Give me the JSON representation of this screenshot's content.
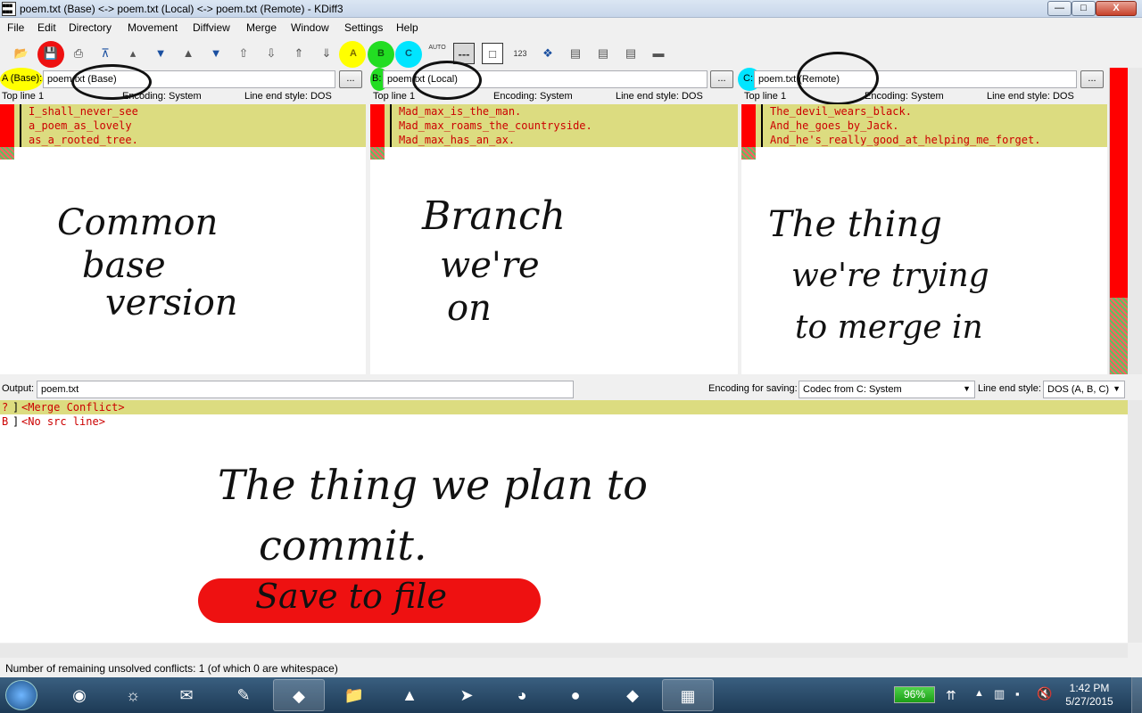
{
  "window": {
    "title": "poem.txt (Base) <-> poem.txt (Local) <-> poem.txt (Remote) - KDiff3",
    "controls": {
      "minimize": "—",
      "maximize": "□",
      "close": "X"
    }
  },
  "menu": [
    "File",
    "Edit",
    "Directory",
    "Movement",
    "Diffview",
    "Merge",
    "Window",
    "Settings",
    "Help"
  ],
  "toolbar": {
    "a": "A",
    "b": "B",
    "c": "C",
    "auto": "AUTO",
    "num": "123"
  },
  "panes": [
    {
      "label": "A (Base):",
      "file": "poem.txt (Base)",
      "top_line": "Top line 1",
      "encoding": "Encoding: System",
      "line_end": "Line end style: DOS",
      "lines": [
        "I_shall_never_see",
        "a_poem_as_lovely",
        "as_a_rooted_tree."
      ],
      "annotation": [
        "Common",
        "base",
        "version"
      ]
    },
    {
      "label": "B:",
      "file": "poem.txt (Local)",
      "top_line": "Top line 1",
      "encoding": "Encoding: System",
      "line_end": "Line end style: DOS",
      "lines": [
        "Mad_max_is_the_man.",
        "Mad_max_roams_the_countryside.",
        "Mad_max_has_an_ax."
      ],
      "annotation": [
        "Branch",
        "we're",
        "on"
      ]
    },
    {
      "label": "C:",
      "file": "poem.txt (Remote)",
      "top_line": "Top line 1",
      "encoding": "Encoding: System",
      "line_end": "Line end style: DOS",
      "lines": [
        "The_devil_wears_black.",
        "And_he_goes_by_Jack.",
        "And_he's_really_good_at_helping_me_forget."
      ],
      "annotation": [
        "The thing",
        "we're trying",
        "to merge in"
      ]
    }
  ],
  "file_button": "...",
  "output": {
    "label": "Output:",
    "file": "poem.txt",
    "encoding_label": "Encoding for saving:",
    "encoding_value": "Codec from C: System",
    "line_end_label": "Line end style:",
    "line_end_value": "DOS (A, B, C)",
    "lines": [
      {
        "marker": "?",
        "text": "<Merge Conflict>"
      },
      {
        "marker": "B",
        "text": "<No src line>"
      }
    ],
    "annotation": [
      "The thing we plan to",
      "commit."
    ],
    "save_note": "Save to file"
  },
  "status": "Number of remaining unsolved conflicts: 1 (of which 0 are whitespace)",
  "taskbar": {
    "battery": "96%",
    "time": "1:42 PM",
    "date": "5/27/2015"
  },
  "colors": {
    "conflict_highlight": "#dcdc80",
    "diff_text": "#cc0000",
    "a_marker": "#ffff00",
    "b_marker": "#22dd22",
    "c_marker": "#00e5ff",
    "save_marker": "#ee1111"
  }
}
